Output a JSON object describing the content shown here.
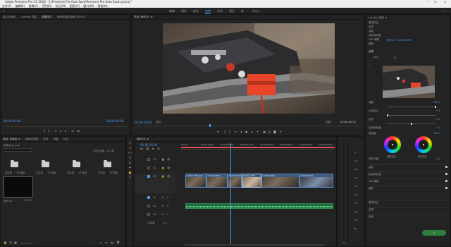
{
  "window": {
    "title": "Adobe Premiere Pro CC 2018 - C:\\Premiere Pro Auto Save\\Premiere Pro Auto Save\\.prproj *",
    "controls": [
      "—",
      "☐",
      "✕"
    ]
  },
  "menu": [
    "文件(F)",
    "编辑(E)",
    "剪辑(C)",
    "序列(S)",
    "标记(M)",
    "图形(G)",
    "窗口(W)",
    "帮助(H)"
  ],
  "workspaces": {
    "items": [
      "编辑",
      "组件",
      "颜色",
      "效果",
      "音频",
      "图形",
      "库",
      "Sony"
    ],
    "active_index": 3
  },
  "source_panel": {
    "tabs": [
      "源:(无剪辑)",
      "Lumetri 范围",
      "效果控件",
      "音频剪辑混合器: 序列 01"
    ],
    "active_index": 2,
    "timecode_left": "00:00:00:00",
    "timecode_right": "00:00:00:00"
  },
  "program_monitor": {
    "tab": "节目: 序列 01 ≡",
    "timecode": "00;00;16;00",
    "fit": "适合",
    "quality": "完整",
    "duration": "00;00;30;15"
  },
  "project_panel": {
    "tabs": [
      "项目: 未命名 ≡",
      "媒体浏览器",
      "信息",
      "效果",
      "标记"
    ],
    "project_name": "未命名.prproj",
    "item_count": "1 项已选择，共 5 项",
    "folders": [
      {
        "name": "文件夹",
        "meta": "1个项目"
      },
      {
        "name": "文件夹",
        "meta": "1个项目"
      },
      {
        "name": "文件夹",
        "meta": "1个项目"
      },
      {
        "name": "文件夹",
        "meta": "1个项目"
      }
    ],
    "sequence": {
      "name": "序列 01",
      "meta": "30;15"
    }
  },
  "timeline": {
    "tab": "序列 01 ≡",
    "timecode": "00;00;16;00",
    "ruler": [
      "00;00",
      "00;00;04;00",
      "00;00;08;00",
      "00;00;12;00",
      "00;00;16;00",
      "00;00;20;00",
      "00;00;24;00",
      "00;00;28;00"
    ],
    "tracks": [
      "V3",
      "V2",
      "V1",
      "A1",
      "A2",
      "A3",
      "主声道"
    ],
    "master_value": "0.0",
    "clips": [
      {
        "label": "C0001.MP4 [V]"
      },
      {
        "label": "C0002.MP4"
      },
      {
        "label": "C0003.MP4"
      },
      {
        "label": "C0004.MP4"
      },
      {
        "label": "C0005.MP4"
      },
      {
        "label": "C0006.MP4"
      }
    ],
    "playhead_fraction": 0.33
  },
  "audio_meter": {
    "scale": [
      "0",
      "-6",
      "-12",
      "-18",
      "-24",
      "-30",
      "-36",
      "-42",
      "-48",
      "-54",
      "dB"
    ],
    "footer": "S S"
  },
  "lumetri": {
    "tabs": [
      "Lumetri 颜色 ≡",
      "库"
    ],
    "sections": [
      "基本校正",
      "创意",
      "曲线",
      "色轮和匹配",
      "HSL 辅助",
      "晕影"
    ],
    "clip_name": "序列 01 * C0003.MP4",
    "input_lut_label": "输入 LUT",
    "input_lut_value": "无",
    "preview_label": "Look",
    "creative_fields": [
      {
        "label": "强度",
        "value": "100.0"
      },
      {
        "label": "淡化胶片",
        "value": "0.0"
      },
      {
        "label": "锐化",
        "value": "0.0"
      },
      {
        "label": "自然饱和度",
        "value": "0.0"
      },
      {
        "label": "饱和度",
        "value": "100.0"
      }
    ],
    "wheel_labels": [
      "阴影减淡",
      "高光色彩"
    ],
    "balance_label": "色彩平衡",
    "balance_value": "0.0",
    "collapsed_sections": [
      "曲线",
      "色轮和匹配",
      "HSL 辅助",
      "晕影",
      "基本校正",
      "创意",
      "曲线"
    ],
    "check_state": "✓"
  },
  "colors": {
    "accent": "#4d9ff0",
    "clip_video": "#3a5a80",
    "clip_audio": "#1f6a3e",
    "playhead": "#4d9ff0",
    "workarea": "#e05050"
  }
}
